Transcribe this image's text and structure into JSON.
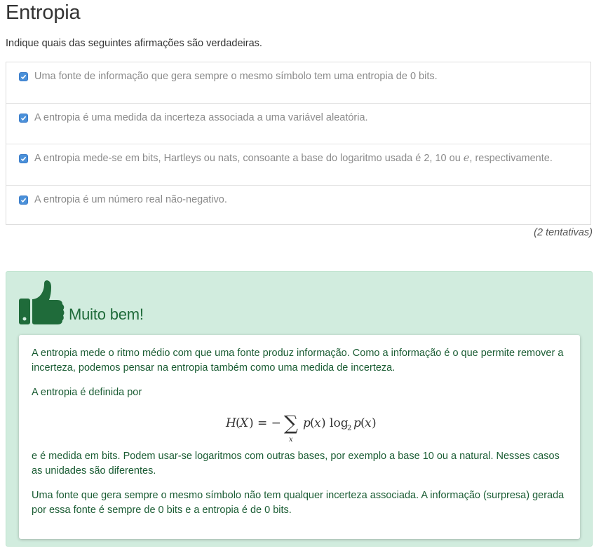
{
  "question": {
    "title": "Entropia",
    "instruction": "Indique quais das seguintes afirmações são verdadeiras.",
    "options": [
      {
        "label": "Uma fonte de informação que gera sempre o mesmo símbolo tem uma entropia de 0 bits.",
        "checked": true
      },
      {
        "label": "A entropia é uma medida da incerteza associada a uma variável aleatória.",
        "checked": true
      },
      {
        "label_before": "A entropia mede-se em bits, Hartleys ou nats, consoante a base do logaritmo usada é 2, 10 ou ",
        "label_math": "e",
        "label_after": ", respectivamente.",
        "checked": true
      },
      {
        "label": "A entropia é um número real não-negativo.",
        "checked": true
      }
    ],
    "attempts": "(2 tentativas)"
  },
  "feedback": {
    "icon": "thumbs-up-icon",
    "title": "Muito bem!",
    "paragraph1": "A entropia mede o ritmo médio com que uma fonte produz informação. Como a informação é o que permite remover a incerteza, podemos pensar na entropia também como uma medida de incerteza.",
    "paragraph2": "A entropia é definida por",
    "formula": "H(X) = −∑ₓ p(x) log₂ p(x)",
    "paragraph3": "e é medida em bits. Podem usar-se logaritmos com outras bases, por exemplo a base 10 ou a natural. Nesses casos as unidades são diferentes.",
    "paragraph4": "Uma fonte que gera sempre o mesmo símbolo não tem qualquer incerteza associada. A informação (surpresa) gerada por essa fonte é sempre de 0 bits e a entropia é de 0 bits."
  },
  "colors": {
    "feedback_bg": "#d1ecde",
    "feedback_text": "#1a5c33",
    "icon": "#1f6b3a",
    "checkbox": "#4a90d9"
  }
}
